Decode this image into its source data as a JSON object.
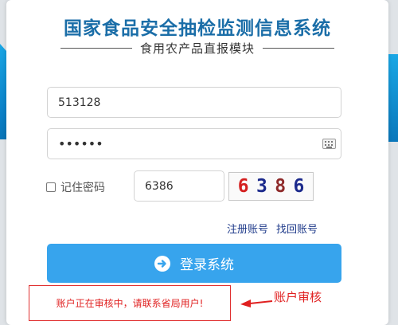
{
  "header": {
    "title": "国家食品安全抽检监测信息系统",
    "subtitle": "食用农产品直报模块"
  },
  "form": {
    "username_value": "513128",
    "password_value": "••••••",
    "remember_label": "记住密码",
    "captcha_value": "6386",
    "captcha_chars": [
      {
        "char": "6",
        "color": "#d42020"
      },
      {
        "char": "3",
        "color": "#1c2a8c"
      },
      {
        "char": "8",
        "color": "#8e2a2a"
      },
      {
        "char": "6",
        "color": "#1c2a8c"
      }
    ],
    "register_link": "注册账号",
    "recover_link": "找回账号",
    "login_button": "登录系统"
  },
  "error": {
    "message": "账户正在审核中，请联系省局用户!"
  },
  "annotation": {
    "label": "账户审核"
  },
  "colors": {
    "title": "#1b6ea8",
    "button": "#37a4ed",
    "error": "#e02020"
  }
}
